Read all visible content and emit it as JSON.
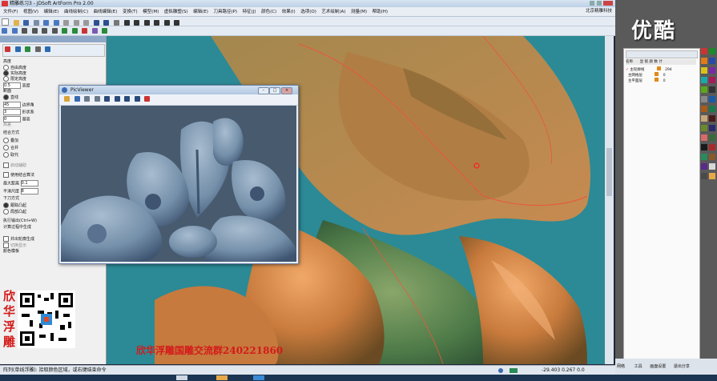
{
  "window": {
    "title": "精雕练习3 - JDSoft ArtForm Pro 2.00"
  },
  "menu": [
    "文件(F)",
    "视图(V)",
    "编辑(E)",
    "曲线绘制(C)",
    "曲线编辑(E)",
    "变换(T)",
    "模型(M)",
    "虚拟雕塑(S)",
    "编辑(E)",
    "刀具路径(P)",
    "特征(J)",
    "颜色(C)",
    "效果(I)",
    "选项(O)",
    "艺术绘制(A)",
    "测量(M)",
    "帮助(H)"
  ],
  "menu_right": "北京精雕科技",
  "left_panel": {
    "items": [
      {
        "type": "label",
        "text": "高度"
      },
      {
        "type": "radio",
        "text": "自由高度"
      },
      {
        "type": "radio",
        "text": "实际高度",
        "checked": true
      },
      {
        "type": "radio",
        "text": "限定高度"
      },
      {
        "type": "field",
        "value": "0.5",
        "text": "高度"
      },
      {
        "type": "label",
        "text": "断面"
      },
      {
        "type": "radio",
        "text": "直线",
        "checked": true
      },
      {
        "type": "field",
        "value": "45",
        "text": "边界角"
      },
      {
        "type": "field",
        "value": "3",
        "text": "形状系"
      },
      {
        "type": "field",
        "value": "0",
        "text": "基高"
      },
      {
        "type": "label",
        "text": "高差"
      },
      {
        "type": "label",
        "text": "结合方式"
      },
      {
        "type": "radio",
        "text": "叠加"
      },
      {
        "type": "radio",
        "text": "合并"
      },
      {
        "type": "radio",
        "text": "取代"
      },
      {
        "type": "check",
        "text": "启动辅助"
      },
      {
        "type": "check",
        "text": "使用结合算法"
      },
      {
        "type": "field",
        "value": "0.1",
        "text": "最大距离"
      },
      {
        "type": "field",
        "value": "8",
        "text": "平滑尺度"
      },
      {
        "type": "label",
        "text": "下刀方式"
      },
      {
        "type": "radio",
        "text": "跟踪凸起"
      },
      {
        "type": "radio",
        "text": "局部凸起"
      },
      {
        "type": "label",
        "text": "执行输出(Ctrl+W)"
      },
      {
        "type": "label",
        "text": "计算过程中生成"
      },
      {
        "type": "check",
        "text": "并出轮廓生成"
      },
      {
        "type": "check",
        "text": "切换显示"
      },
      {
        "type": "label",
        "text": "颜色模板"
      }
    ]
  },
  "viewer": {
    "title": "PicViewer"
  },
  "right_panel": {
    "columns": [
      "名称",
      "显",
      "锁",
      "颜",
      "数",
      "计"
    ],
    "layers": [
      {
        "name": "主轮廓线",
        "count": "294"
      },
      {
        "name": "主网格层",
        "count": "0"
      },
      {
        "name": "主平面层",
        "count": "0"
      }
    ]
  },
  "watermark": "优酷",
  "qr_caption": [
    "欣",
    "华",
    "浮",
    "雕"
  ],
  "overlay_text": "欣华浮雕国雕交流群240221860",
  "status": {
    "message": "阵列(单线浮雕): 拾取颜色区域，或右键结束命令",
    "coords": "-29.403 0.267 0.0",
    "buttons": [
      "网络",
      "工具",
      "画面设置",
      "退出分享"
    ]
  },
  "colors": {
    "accent": "#d41a1a",
    "canvas_bg": "#2b8a96",
    "relief_orange": "#d6824a",
    "relief_green": "#3f7a4a"
  }
}
